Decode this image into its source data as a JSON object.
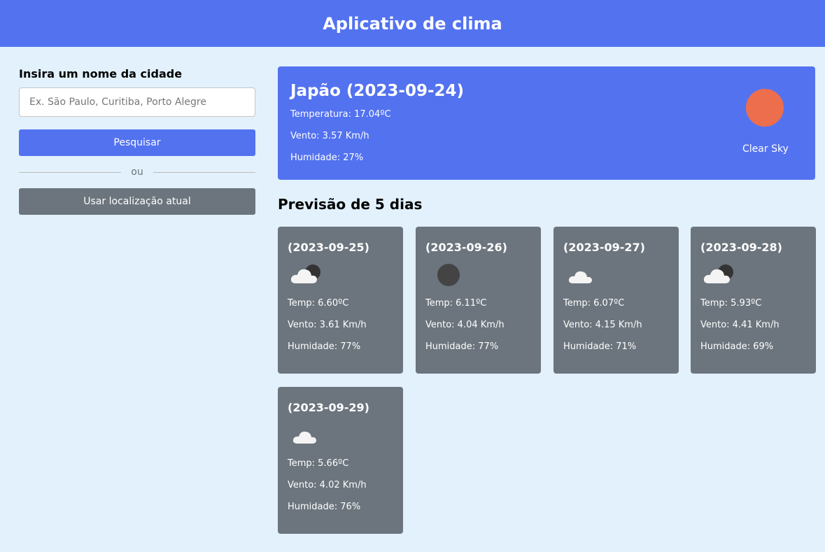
{
  "header": {
    "title": "Aplicativo de clima"
  },
  "search": {
    "label": "Insira um nome da cidade",
    "placeholder": "Ex. São Paulo, Curitiba, Porto Alegre",
    "value": "",
    "search_button": "Pesquisar",
    "separator": "ou",
    "location_button": "Usar localização atual"
  },
  "current": {
    "title": "Japão (2023-09-24)",
    "temperature": "Temperatura: 17.04ºC",
    "wind": "Vento: 3.57 Km/h",
    "humidity": "Humidade: 27%",
    "description": "Clear Sky",
    "icon": "sun-icon",
    "icon_color": "#ec6e4c"
  },
  "forecast": {
    "title": "Previsão de 5 dias",
    "days": [
      {
        "date": "(2023-09-25)",
        "temp": "Temp: 6.60ºC",
        "wind": "Vento: 3.61 Km/h",
        "humidity": "Humidade: 77%",
        "icon": "cloud-night-icon"
      },
      {
        "date": "(2023-09-26)",
        "temp": "Temp: 6.11ºC",
        "wind": "Vento: 4.04 Km/h",
        "humidity": "Humidade: 77%",
        "icon": "moon-icon"
      },
      {
        "date": "(2023-09-27)",
        "temp": "Temp: 6.07ºC",
        "wind": "Vento: 4.15 Km/h",
        "humidity": "Humidade: 71%",
        "icon": "cloud-icon"
      },
      {
        "date": "(2023-09-28)",
        "temp": "Temp: 5.93ºC",
        "wind": "Vento: 4.41 Km/h",
        "humidity": "Humidade: 69%",
        "icon": "cloud-night-icon"
      },
      {
        "date": "(2023-09-29)",
        "temp": "Temp: 5.66ºC",
        "wind": "Vento: 4.02 Km/h",
        "humidity": "Humidade: 76%",
        "icon": "cloud-icon"
      }
    ]
  },
  "colors": {
    "primary": "#5372f0",
    "secondary": "#6c757d",
    "background": "#e2f1fc"
  }
}
